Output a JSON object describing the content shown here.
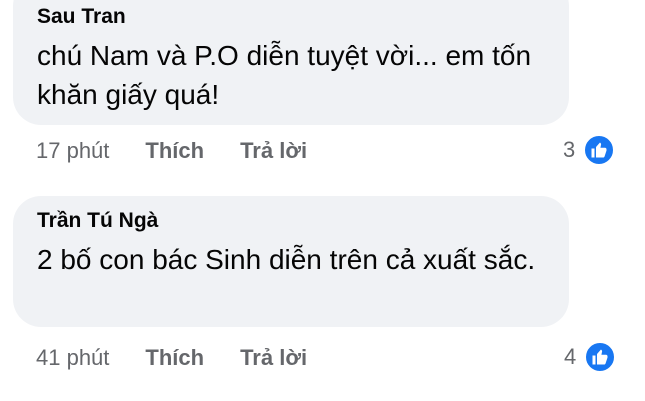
{
  "comments": [
    {
      "author": "Sau Tran",
      "text": "chú Nam và P.O diễn tuyệt vời... em tốn khăn giấy quá!",
      "time": "17 phút",
      "like_label": "Thích",
      "reply_label": "Trả lời",
      "reaction_count": "3",
      "reaction_icon": "thumbs-up-icon"
    },
    {
      "author": "Trần Tú Ngà",
      "text": "2 bố con bác Sinh diễn trên cả xuất sắc.",
      "time": "41 phút",
      "like_label": "Thích",
      "reply_label": "Trả lời",
      "reaction_count": "4",
      "reaction_icon": "thumbs-up-icon"
    }
  ],
  "colors": {
    "bubble_bg": "#f0f2f5",
    "text_primary": "#050505",
    "text_secondary": "#65676b",
    "like_blue": "#1877f2"
  }
}
